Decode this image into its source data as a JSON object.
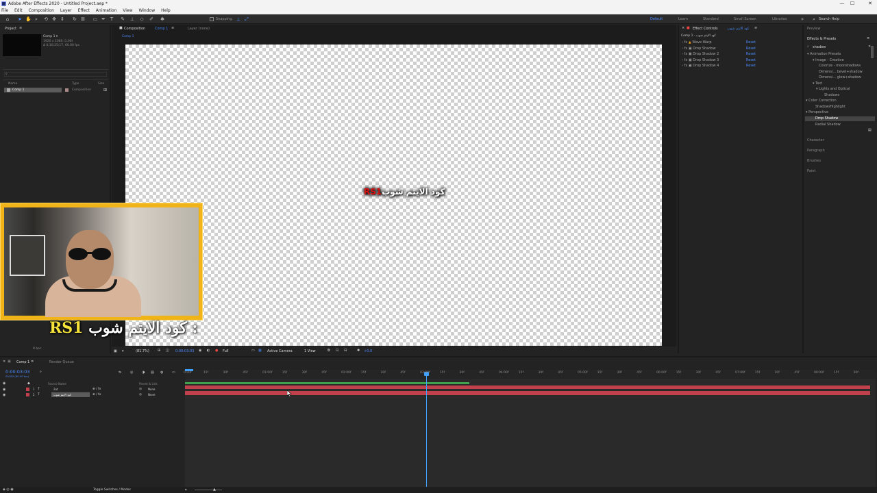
{
  "window": {
    "title": "Adobe After Effects 2020 - Untitled Project.aep *",
    "controls": [
      "—",
      "☐",
      "✕"
    ]
  },
  "menu": [
    "File",
    "Edit",
    "Composition",
    "Layer",
    "Effect",
    "Animation",
    "View",
    "Window",
    "Help"
  ],
  "toolbar": {
    "snapping": "Snapping",
    "workspaces": [
      "Default",
      "Learn",
      "Standard",
      "Small Screen",
      "Libraries"
    ],
    "search_help": "Search Help"
  },
  "project": {
    "tab": "Project",
    "comp_name": "Comp 1 ▾",
    "comp_info": "1920 x 1080 (1.00)",
    "comp_duration": "Δ 0;10;25;17, 60.00 fps",
    "columns": [
      "Name",
      "Type",
      "Size"
    ],
    "item_name": "Comp 1",
    "item_type": "Composition",
    "bpc": "8 bpc"
  },
  "viewer": {
    "tab": "Composition",
    "tab_comp": "Comp 1",
    "tab_menu": "≡",
    "layer_tab": "Layer (none)",
    "breadcrumb": "Comp 1",
    "text_white": "كود الايتم شوب",
    "text_red": "RS1",
    "zoom": "(81.7%)",
    "timecode": "0:00:03:03",
    "quality": "Full",
    "camera": "Active Camera",
    "view": "1 View",
    "exposure": "+0.0"
  },
  "effect_controls": {
    "tab": "Effect Controls",
    "tab_layer": "كود الايتم شوب",
    "tab_menu": "≡",
    "layer_path": "Comp 1 · كود الايتم شوب",
    "effects": [
      {
        "name": "Wave Warp",
        "reset": "Reset"
      },
      {
        "name": "Drop Shadow",
        "reset": "Reset"
      },
      {
        "name": "Drop Shadow 2",
        "reset": "Reset"
      },
      {
        "name": "Drop Shadow 3",
        "reset": "Reset"
      },
      {
        "name": "Drop Shadow 4",
        "reset": "Reset"
      }
    ]
  },
  "effects_presets": {
    "preview": "Preview",
    "tab": "Effects & Presets",
    "search": "shadow",
    "tree": [
      "▾ Animation Presets",
      "▾ Image - Creative",
      "Colorize - moonshadows",
      "Dimensi... bevel+shadow",
      "Dimensi... glow+shadow",
      "▾ Text",
      "▾ Lights and Optical",
      "Shadows",
      "▾ Color Correction",
      "Shadow/Highlight",
      "▾ Perspective",
      "Drop Shadow",
      "Radial Shadow"
    ],
    "panels": [
      "Character",
      "Paragraph",
      "Brushes",
      "Paint"
    ]
  },
  "caption": {
    "yellow": "RS1",
    "white": "كود الايتم شوب :"
  },
  "timeline": {
    "tab": "Comp 1",
    "render_queue": "Render Queue",
    "timecode": "0:00:03:03",
    "frame_info": "00183 (60.00 fps)",
    "columns": [
      "Source Name",
      "Parent & Link"
    ],
    "layers": [
      {
        "num": "1",
        "name": "2ot",
        "parent": "None"
      },
      {
        "num": "2",
        "name": "كود الايتم شوب",
        "parent": "None"
      }
    ],
    "ticks": [
      "0:00f",
      "15f",
      "30f",
      "45f",
      "01:00f",
      "15f",
      "30f",
      "45f",
      "02:00f",
      "15f",
      "30f",
      "45f",
      "03:00f",
      "15f",
      "30f",
      "45f",
      "04:00f",
      "15f",
      "30f",
      "45f",
      "05:00f",
      "15f",
      "30f",
      "45f",
      "06:00f",
      "15f",
      "30f",
      "45f",
      "07:00f",
      "15f",
      "30f",
      "45f",
      "08:00f",
      "15f",
      "30f"
    ],
    "toggle": "Toggle Switches / Modes"
  },
  "colors": {
    "accent": "#3ea1ff",
    "layer_bar": "#c0414c",
    "work_area": "#3fa34d",
    "cam_frame": "#f0b418"
  }
}
